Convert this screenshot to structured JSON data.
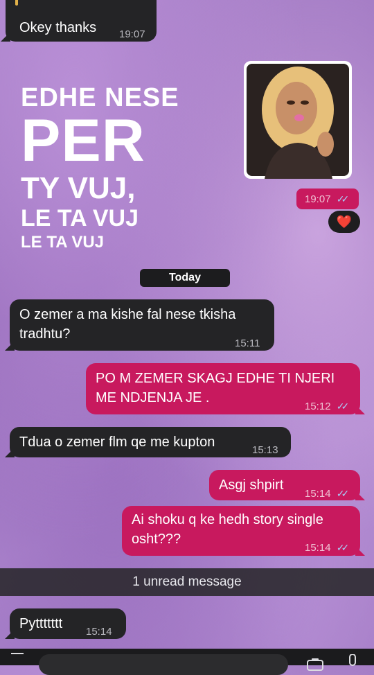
{
  "messages": {
    "m0_text": "Okey thanks",
    "m0_time": "19:07",
    "sticker_time": "19:07",
    "reaction": "❤️",
    "date_label": "Today",
    "m1_text": "O zemer a ma kishe fal nese tkisha tradhtu?",
    "m1_time": "15:11",
    "m2_text": "PO M ZEMER SKAGJ EDHE TI NJERI ME NDJENJA JE .",
    "m2_time": "15:12",
    "m3_text": "Tdua o zemer flm qe me kupton",
    "m3_time": "15:13",
    "m4_text": "Asgj shpirt",
    "m4_time": "15:14",
    "m5_text": "Ai shoku q ke hedh story single osht???",
    "m5_time": "15:14",
    "unread_label": "1 unread message",
    "m6_text": "Pyttttttt",
    "m6_time": "15:14",
    "ticks": "✓✓"
  },
  "overlay_text": {
    "line1": "EDHE NESE",
    "line2": "PER",
    "line3": "TY VUJ,",
    "line4": "LE TA VUJ",
    "line5": "LE TA VUJ"
  },
  "icons": [
    "double-check-icon",
    "heart-reaction-icon",
    "camera-icon",
    "microphone-icon",
    "plus-icon"
  ]
}
